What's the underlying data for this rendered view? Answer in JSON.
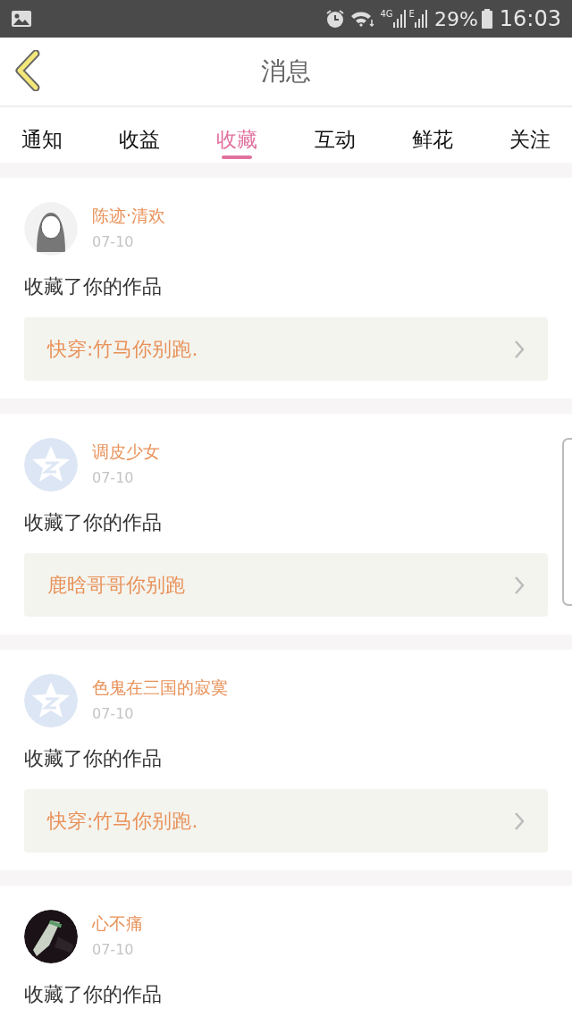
{
  "status_bar": {
    "network_labels": [
      "4G",
      "E"
    ],
    "battery": "29%",
    "time": "16:03"
  },
  "header": {
    "title": "消息"
  },
  "tabs": [
    {
      "label": "通知",
      "selected": false
    },
    {
      "label": "收益",
      "selected": false
    },
    {
      "label": "收藏",
      "selected": true
    },
    {
      "label": "互动",
      "selected": false
    },
    {
      "label": "鲜花",
      "selected": false
    },
    {
      "label": "关注",
      "selected": false
    }
  ],
  "messages": [
    {
      "avatar": {
        "kind": "drawing"
      },
      "user": "陈迹·清欢",
      "date": "07-10",
      "action": "收藏了你的作品",
      "work": "快穿:竹马你别跑."
    },
    {
      "avatar": {
        "kind": "default"
      },
      "user": "调皮少女",
      "date": "07-10",
      "action": "收藏了你的作品",
      "work": "鹿晗哥哥你别跑"
    },
    {
      "avatar": {
        "kind": "default"
      },
      "user": "色鬼在三国的寂寞",
      "date": "07-10",
      "action": "收藏了你的作品",
      "work": "快穿:竹马你别跑."
    },
    {
      "user": "心不痛",
      "date": "07-10",
      "action": "收藏了你的作品"
    }
  ]
}
